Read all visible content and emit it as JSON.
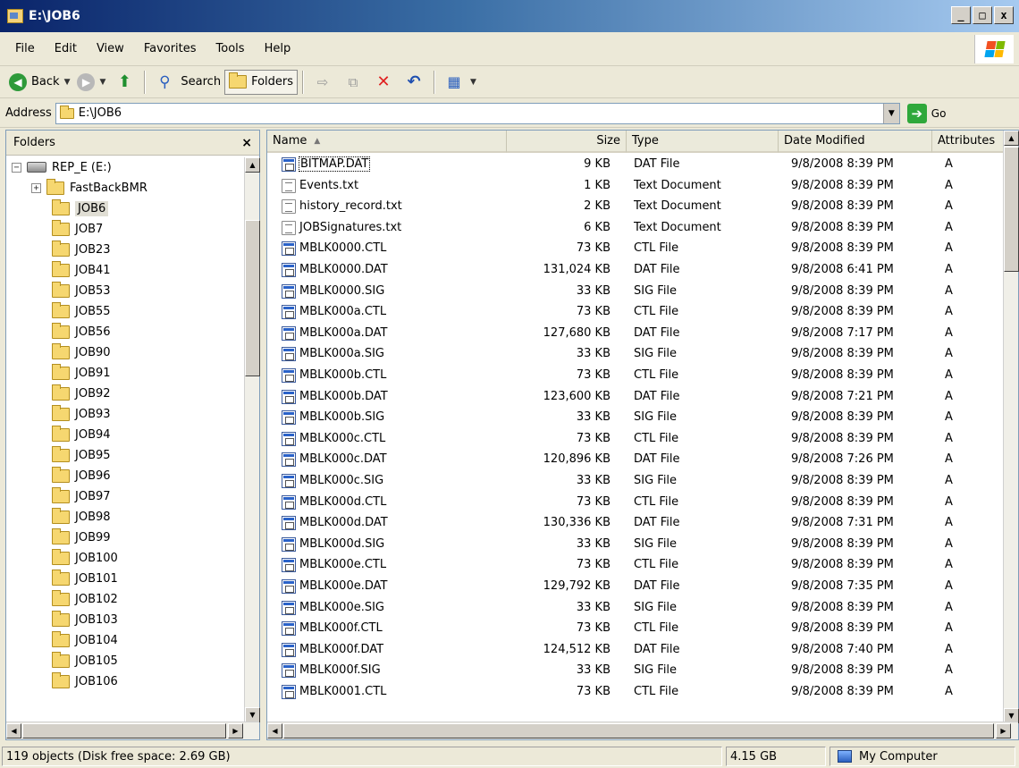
{
  "window": {
    "title": "E:\\JOB6",
    "min": "_",
    "max": "□",
    "close": "x"
  },
  "menu": [
    "File",
    "Edit",
    "View",
    "Favorites",
    "Tools",
    "Help"
  ],
  "toolbar": {
    "back": "Back",
    "search": "Search",
    "folders": "Folders"
  },
  "address": {
    "label": "Address",
    "value": "E:\\JOB6",
    "go": "Go"
  },
  "folders_pane": {
    "title": "Folders",
    "close": "×",
    "tree": [
      {
        "label": "REP_E (E:)",
        "level": 0,
        "expander": "−",
        "icon": "drive"
      },
      {
        "label": "FastBackBMR",
        "level": 1,
        "expander": "+",
        "icon": "folder"
      },
      {
        "label": "JOB6",
        "level": 1,
        "icon": "folder",
        "selected": true
      },
      {
        "label": "JOB7",
        "level": 1,
        "icon": "folder"
      },
      {
        "label": "JOB23",
        "level": 1,
        "icon": "folder"
      },
      {
        "label": "JOB41",
        "level": 1,
        "icon": "folder"
      },
      {
        "label": "JOB53",
        "level": 1,
        "icon": "folder"
      },
      {
        "label": "JOB55",
        "level": 1,
        "icon": "folder"
      },
      {
        "label": "JOB56",
        "level": 1,
        "icon": "folder"
      },
      {
        "label": "JOB90",
        "level": 1,
        "icon": "folder"
      },
      {
        "label": "JOB91",
        "level": 1,
        "icon": "folder"
      },
      {
        "label": "JOB92",
        "level": 1,
        "icon": "folder"
      },
      {
        "label": "JOB93",
        "level": 1,
        "icon": "folder"
      },
      {
        "label": "JOB94",
        "level": 1,
        "icon": "folder"
      },
      {
        "label": "JOB95",
        "level": 1,
        "icon": "folder"
      },
      {
        "label": "JOB96",
        "level": 1,
        "icon": "folder"
      },
      {
        "label": "JOB97",
        "level": 1,
        "icon": "folder"
      },
      {
        "label": "JOB98",
        "level": 1,
        "icon": "folder"
      },
      {
        "label": "JOB99",
        "level": 1,
        "icon": "folder"
      },
      {
        "label": "JOB100",
        "level": 1,
        "icon": "folder"
      },
      {
        "label": "JOB101",
        "level": 1,
        "icon": "folder"
      },
      {
        "label": "JOB102",
        "level": 1,
        "icon": "folder"
      },
      {
        "label": "JOB103",
        "level": 1,
        "icon": "folder"
      },
      {
        "label": "JOB104",
        "level": 1,
        "icon": "folder"
      },
      {
        "label": "JOB105",
        "level": 1,
        "icon": "folder"
      },
      {
        "label": "JOB106",
        "level": 1,
        "icon": "folder"
      }
    ]
  },
  "columns": {
    "name": "Name",
    "size": "Size",
    "type": "Type",
    "date": "Date Modified",
    "attributes": "Attributes"
  },
  "files": [
    {
      "name": "BITMAP.DAT",
      "size": "9 KB",
      "type": "DAT File",
      "date": "9/8/2008 8:39 PM",
      "attr": "A",
      "icon": "dat"
    },
    {
      "name": "Events.txt",
      "size": "1 KB",
      "type": "Text Document",
      "date": "9/8/2008 8:39 PM",
      "attr": "A",
      "icon": "txt"
    },
    {
      "name": "history_record.txt",
      "size": "2 KB",
      "type": "Text Document",
      "date": "9/8/2008 8:39 PM",
      "attr": "A",
      "icon": "txt"
    },
    {
      "name": "JOBSignatures.txt",
      "size": "6 KB",
      "type": "Text Document",
      "date": "9/8/2008 8:39 PM",
      "attr": "A",
      "icon": "txt"
    },
    {
      "name": "MBLK0000.CTL",
      "size": "73 KB",
      "type": "CTL File",
      "date": "9/8/2008 8:39 PM",
      "attr": "A",
      "icon": "dat"
    },
    {
      "name": "MBLK0000.DAT",
      "size": "131,024 KB",
      "type": "DAT File",
      "date": "9/8/2008 6:41 PM",
      "attr": "A",
      "icon": "dat"
    },
    {
      "name": "MBLK0000.SIG",
      "size": "33 KB",
      "type": "SIG File",
      "date": "9/8/2008 8:39 PM",
      "attr": "A",
      "icon": "dat"
    },
    {
      "name": "MBLK000a.CTL",
      "size": "73 KB",
      "type": "CTL File",
      "date": "9/8/2008 8:39 PM",
      "attr": "A",
      "icon": "dat"
    },
    {
      "name": "MBLK000a.DAT",
      "size": "127,680 KB",
      "type": "DAT File",
      "date": "9/8/2008 7:17 PM",
      "attr": "A",
      "icon": "dat"
    },
    {
      "name": "MBLK000a.SIG",
      "size": "33 KB",
      "type": "SIG File",
      "date": "9/8/2008 8:39 PM",
      "attr": "A",
      "icon": "dat"
    },
    {
      "name": "MBLK000b.CTL",
      "size": "73 KB",
      "type": "CTL File",
      "date": "9/8/2008 8:39 PM",
      "attr": "A",
      "icon": "dat"
    },
    {
      "name": "MBLK000b.DAT",
      "size": "123,600 KB",
      "type": "DAT File",
      "date": "9/8/2008 7:21 PM",
      "attr": "A",
      "icon": "dat"
    },
    {
      "name": "MBLK000b.SIG",
      "size": "33 KB",
      "type": "SIG File",
      "date": "9/8/2008 8:39 PM",
      "attr": "A",
      "icon": "dat"
    },
    {
      "name": "MBLK000c.CTL",
      "size": "73 KB",
      "type": "CTL File",
      "date": "9/8/2008 8:39 PM",
      "attr": "A",
      "icon": "dat"
    },
    {
      "name": "MBLK000c.DAT",
      "size": "120,896 KB",
      "type": "DAT File",
      "date": "9/8/2008 7:26 PM",
      "attr": "A",
      "icon": "dat"
    },
    {
      "name": "MBLK000c.SIG",
      "size": "33 KB",
      "type": "SIG File",
      "date": "9/8/2008 8:39 PM",
      "attr": "A",
      "icon": "dat"
    },
    {
      "name": "MBLK000d.CTL",
      "size": "73 KB",
      "type": "CTL File",
      "date": "9/8/2008 8:39 PM",
      "attr": "A",
      "icon": "dat"
    },
    {
      "name": "MBLK000d.DAT",
      "size": "130,336 KB",
      "type": "DAT File",
      "date": "9/8/2008 7:31 PM",
      "attr": "A",
      "icon": "dat"
    },
    {
      "name": "MBLK000d.SIG",
      "size": "33 KB",
      "type": "SIG File",
      "date": "9/8/2008 8:39 PM",
      "attr": "A",
      "icon": "dat"
    },
    {
      "name": "MBLK000e.CTL",
      "size": "73 KB",
      "type": "CTL File",
      "date": "9/8/2008 8:39 PM",
      "attr": "A",
      "icon": "dat"
    },
    {
      "name": "MBLK000e.DAT",
      "size": "129,792 KB",
      "type": "DAT File",
      "date": "9/8/2008 7:35 PM",
      "attr": "A",
      "icon": "dat"
    },
    {
      "name": "MBLK000e.SIG",
      "size": "33 KB",
      "type": "SIG File",
      "date": "9/8/2008 8:39 PM",
      "attr": "A",
      "icon": "dat"
    },
    {
      "name": "MBLK000f.CTL",
      "size": "73 KB",
      "type": "CTL File",
      "date": "9/8/2008 8:39 PM",
      "attr": "A",
      "icon": "dat"
    },
    {
      "name": "MBLK000f.DAT",
      "size": "124,512 KB",
      "type": "DAT File",
      "date": "9/8/2008 7:40 PM",
      "attr": "A",
      "icon": "dat"
    },
    {
      "name": "MBLK000f.SIG",
      "size": "33 KB",
      "type": "SIG File",
      "date": "9/8/2008 8:39 PM",
      "attr": "A",
      "icon": "dat"
    },
    {
      "name": "MBLK0001.CTL",
      "size": "73 KB",
      "type": "CTL File",
      "date": "9/8/2008 8:39 PM",
      "attr": "A",
      "icon": "dat"
    }
  ],
  "status": {
    "objects": "119 objects (Disk free space: 2.69 GB)",
    "size": "4.15 GB",
    "location": "My Computer"
  },
  "icons": [
    "folder-icon",
    "drive-icon",
    "back-icon",
    "forward-icon",
    "up-icon",
    "search-icon",
    "folders-icon",
    "move-to-icon",
    "copy-to-icon",
    "delete-icon",
    "undo-icon",
    "views-icon",
    "go-icon",
    "windows-logo-icon",
    "computer-icon"
  ]
}
